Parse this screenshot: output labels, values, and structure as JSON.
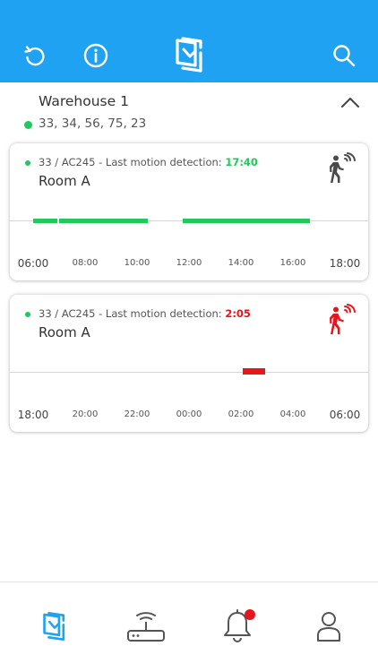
{
  "header": {
    "icons": [
      "refresh-icon",
      "info-icon",
      "app-logo-icon",
      "search-icon"
    ]
  },
  "group": {
    "title": "Warehouse 1",
    "devices": "33, 34, 56, 75, 23",
    "status_color": "#1fc95a",
    "expanded": true
  },
  "cards": [
    {
      "status_prefix": "33 / AC245 - Last motion detection: ",
      "last_detection": "17:40",
      "last_detection_color": "#1fc95a",
      "room": "Room A",
      "motion_icon": "motion-sensor-icon",
      "icon_color": "#4a4a4a",
      "ticks": [
        "06:00",
        "08:00",
        "10:00",
        "12:00",
        "14:00",
        "16:00",
        "18:00"
      ],
      "segments": [
        {
          "start": "06:00",
          "end": "06:55",
          "color": "#1fc95a"
        },
        {
          "start": "07:00",
          "end": "10:25",
          "color": "#1fc95a"
        },
        {
          "start": "11:45",
          "end": "16:40",
          "color": "#1fc95a"
        }
      ]
    },
    {
      "status_prefix": "33 / AC245 - Last motion detection: ",
      "last_detection": "2:05",
      "last_detection_color": "#e8151c",
      "room": "Room A",
      "motion_icon": "motion-sensor-icon",
      "icon_color": "#e8151c",
      "ticks": [
        "18:00",
        "20:00",
        "22:00",
        "00:00",
        "02:00",
        "04:00",
        "06:00"
      ],
      "segments": [
        {
          "start": "02:05",
          "end": "02:55",
          "color": "#e8151c"
        }
      ]
    }
  ],
  "bottom_nav": {
    "items": [
      "devices-nav-icon",
      "router-icon",
      "bell-icon",
      "profile-icon"
    ],
    "active": "devices-nav-icon",
    "alert_badge": true,
    "accent": "#1ea2f1"
  }
}
